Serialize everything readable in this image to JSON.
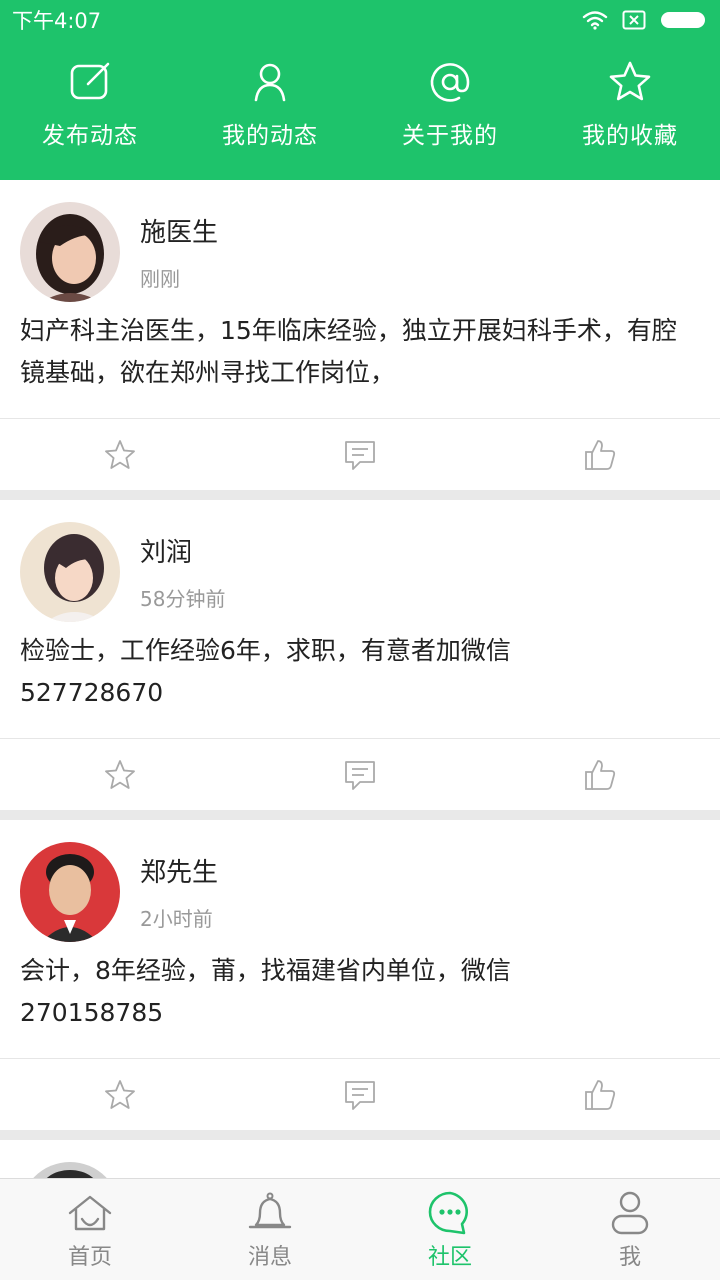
{
  "status_bar": {
    "time": "下午4:07",
    "icons": [
      "wifi-icon",
      "sim-x-icon",
      "battery-icon"
    ]
  },
  "top_actions": [
    {
      "label": "发布动态",
      "icon": "edit-icon"
    },
    {
      "label": "我的动态",
      "icon": "person-icon"
    },
    {
      "label": "关于我的",
      "icon": "at-icon"
    },
    {
      "label": "我的收藏",
      "icon": "star-icon"
    }
  ],
  "posts": [
    {
      "author": "施医生",
      "time": "刚刚",
      "content": "妇产科主治医生，15年临床经验，独立开展妇科手术，有腔镜基础，欲在郑州寻找工作岗位，",
      "avatar": "avatar-woman-1"
    },
    {
      "author": "刘润",
      "time": "58分钟前",
      "content": "检验士，工作经验6年，求职，有意者加微信\n527728670",
      "avatar": "avatar-woman-2"
    },
    {
      "author": "郑先生",
      "time": "2小时前",
      "content": "会计，8年经验，莆，找福建省内单位，微信\n270158785",
      "avatar": "avatar-man-1"
    },
    {
      "author": "",
      "time": "",
      "content": "",
      "avatar": "avatar-partial"
    }
  ],
  "post_action_icons": [
    "star-icon",
    "comment-icon",
    "thumbs-up-icon"
  ],
  "tabs": [
    {
      "label": "首页",
      "icon": "home-icon",
      "active": false
    },
    {
      "label": "消息",
      "icon": "bell-icon",
      "active": false
    },
    {
      "label": "社区",
      "icon": "chat-bubble-icon",
      "active": true
    },
    {
      "label": "我",
      "icon": "user-icon",
      "active": false
    }
  ],
  "colors": {
    "accent": "#1ec36b",
    "muted_text": "#999999",
    "icon_gray": "#aaaaaa",
    "divider": "#e9e9e9"
  }
}
